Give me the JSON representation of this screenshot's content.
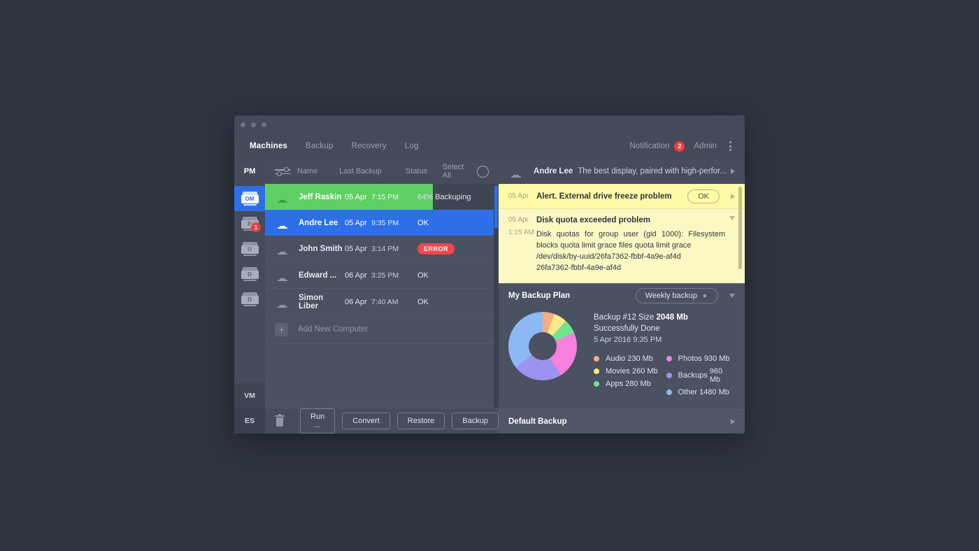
{
  "window": {
    "traffic_lights": [
      "close",
      "minimize",
      "zoom"
    ]
  },
  "menu": {
    "tabs": [
      {
        "label": "Machines",
        "active": true
      },
      {
        "label": "Backup",
        "active": false
      },
      {
        "label": "Recovery",
        "active": false
      },
      {
        "label": "Log",
        "active": false
      }
    ],
    "notification_label": "Notification",
    "notification_count": "2",
    "admin_label": "Admin",
    "more_icon": "kebab-menu-icon"
  },
  "rail": {
    "top_label": "PM",
    "items": [
      {
        "letter": "OM",
        "selected": true,
        "badge": null
      },
      {
        "letter": "P",
        "selected": false,
        "badge": "1"
      },
      {
        "letter": "U",
        "selected": false,
        "badge": null
      },
      {
        "letter": "D",
        "selected": false,
        "badge": null
      },
      {
        "letter": "D",
        "selected": false,
        "badge": null
      }
    ],
    "vm_label": "VM",
    "es_label": "ES"
  },
  "machines": {
    "filter_icon": "filter-sliders-icon",
    "headers": {
      "name": "Name",
      "last_backup": "Last Backup",
      "status": "Status",
      "select_all": "Select All"
    },
    "rows": [
      {
        "name": "Jeff Raskin",
        "date": "05 Apr",
        "time": "7:15 PM",
        "status": "Backuping",
        "percent": "64%",
        "state": "backuping",
        "selected": false,
        "progress": 64
      },
      {
        "name": "Andre Lee",
        "date": "05 Apr",
        "time": "9:35 PM",
        "status": "OK",
        "percent": "",
        "state": "ok",
        "selected": true,
        "progress": 0
      },
      {
        "name": "John Smith",
        "date": "05 Apr",
        "time": "3:14 PM",
        "status": "ERROR",
        "percent": "",
        "state": "error",
        "selected": false,
        "progress": 0
      },
      {
        "name": "Edward ...",
        "date": "06 Apr",
        "time": "3:25 PM",
        "status": "OK",
        "percent": "",
        "state": "ok",
        "selected": false,
        "progress": 0
      },
      {
        "name": "Simon Liber",
        "date": "06 Apr",
        "time": "7:40 AM",
        "status": "OK",
        "percent": "",
        "state": "ok",
        "selected": false,
        "progress": 0
      }
    ],
    "add_new_label": "Add New Computer"
  },
  "footer": {
    "delete_icon": "trash-icon",
    "buttons": [
      "Run ...",
      "Convert",
      "Restore",
      "Backup"
    ]
  },
  "notifications": {
    "header": {
      "name": "Andre Lee",
      "description": "The best display, paired with high-perfor..."
    },
    "alert": {
      "date": "05 Apr",
      "text": "Alert. External drive freeze problem",
      "action_label": "OK"
    },
    "expanded": {
      "date": "05 Apr",
      "time": "1:15 AM",
      "title": "Disk quota exceeded problem",
      "lines": [
        "Disk quotas for group user (gid 1000): Filesystem blocks quota limit grace files quota limit grace",
        "/dev/disk/by-uuid/26fa7362-fbbf-4a9e-af4d",
        "26fa7362-fbbf-4a9e-af4d"
      ]
    }
  },
  "backup_plan": {
    "title": "My Backup Plan",
    "schedule_label": "Weekly backup",
    "gear_icon": "gear-icon",
    "info": {
      "line1_prefix": "Backup #12 Size ",
      "line1_value": "2048 Mb",
      "line2": "Successfully Done",
      "line3": "5 Apr 2016 9:35 PM"
    },
    "chart_data": {
      "type": "pie",
      "title": "Backup #12 Size 2048 Mb",
      "unit": "Mb",
      "total": 4140,
      "categories": [
        "Audio",
        "Movies",
        "Apps",
        "Photos",
        "Backups",
        "Other"
      ],
      "values": [
        230,
        260,
        280,
        930,
        960,
        1480
      ],
      "colors": [
        "#f7ab7f",
        "#fbe98a",
        "#72e48c",
        "#f97fe0",
        "#9b93f0",
        "#8cb8f5"
      ],
      "legend": [
        {
          "label": "Audio",
          "value": "230 Mb",
          "color": "#f7ab7f"
        },
        {
          "label": "Movies",
          "value": "260 Mb",
          "color": "#fbe98a"
        },
        {
          "label": "Apps",
          "value": "280 Mb",
          "color": "#72e48c"
        },
        {
          "label": "Photos",
          "value": "930 Mb",
          "color": "#f97fe0"
        },
        {
          "label": "Backups",
          "value": "960 Mb",
          "color": "#9b93f0"
        },
        {
          "label": "Other",
          "value": "1480 Mb",
          "color": "#8cb8f5"
        }
      ],
      "legend_position": "right",
      "donut": true
    }
  },
  "default_backup": {
    "title": "Default Backup"
  },
  "colors": {
    "accent_blue": "#2d6fe8",
    "progress_green": "#5fcf63",
    "error_red": "#f1464c",
    "alert_yellow": "#fdfaa8",
    "panel_bg": "#4a5160",
    "chrome_bg": "#434a59",
    "page_bg": "#2e3440"
  }
}
